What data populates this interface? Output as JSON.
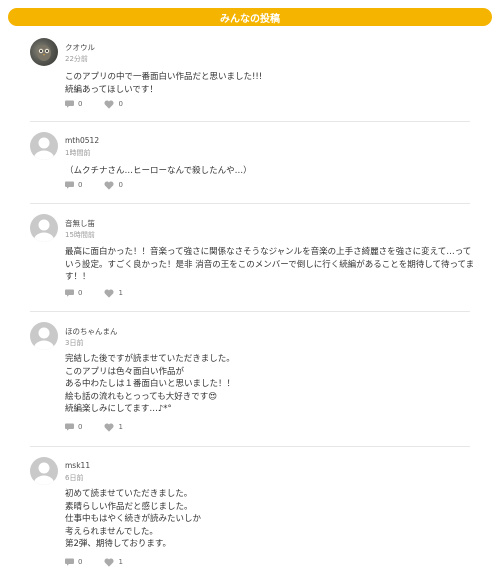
{
  "header": {
    "title": "みんなの投稿"
  },
  "posts": [
    {
      "username": "クオウル",
      "time": "22分前",
      "body": "このアプリの中で一番面白い作品だと思いました!!!\n続編あってほしいです！",
      "comments": "0",
      "likes": "0",
      "avatar": "photo"
    },
    {
      "username": "mth0512",
      "time": "1時間前",
      "body": "（ムクチナさん…ヒーローなんで殺したんや…）",
      "comments": "0",
      "likes": "0",
      "avatar": "default"
    },
    {
      "username": "音無し笛",
      "time": "15時間前",
      "body": "最高に面白かった！！音楽って強さに関係なさそうなジャンルを音楽の上手さ綺麗さを強さに変えて…っていう設定。すごく良かった！是非 消音の王をこのメンバーで倒しに行く続編があることを期待して待ってます！！",
      "comments": "0",
      "likes": "1",
      "avatar": "default"
    },
    {
      "username": "ほのちゃんまん",
      "time": "3日前",
      "body": "完結した後ですが読ませていただきました。\nこのアプリは色々面白い作品が\nある中わたしは１番面白いと思いました！！\n絵も話の流れもとっっても大好きです😍\n続編楽しみにしてます…♪*°",
      "comments": "0",
      "likes": "1",
      "avatar": "default"
    },
    {
      "username": "msk11",
      "time": "6日前",
      "body": "初めて読ませていただきました。\n素晴らしい作品だと感じました。\n仕事中もはやく続きが読みたいしか\n考えられませんでした。\n第2弾、期待しております。",
      "comments": "0",
      "likes": "1",
      "avatar": "default"
    }
  ],
  "icons": {
    "comment": "comment-icon",
    "like": "heart-icon"
  },
  "colors": {
    "header": "#f5b400",
    "icon": "#aaaaaa"
  }
}
